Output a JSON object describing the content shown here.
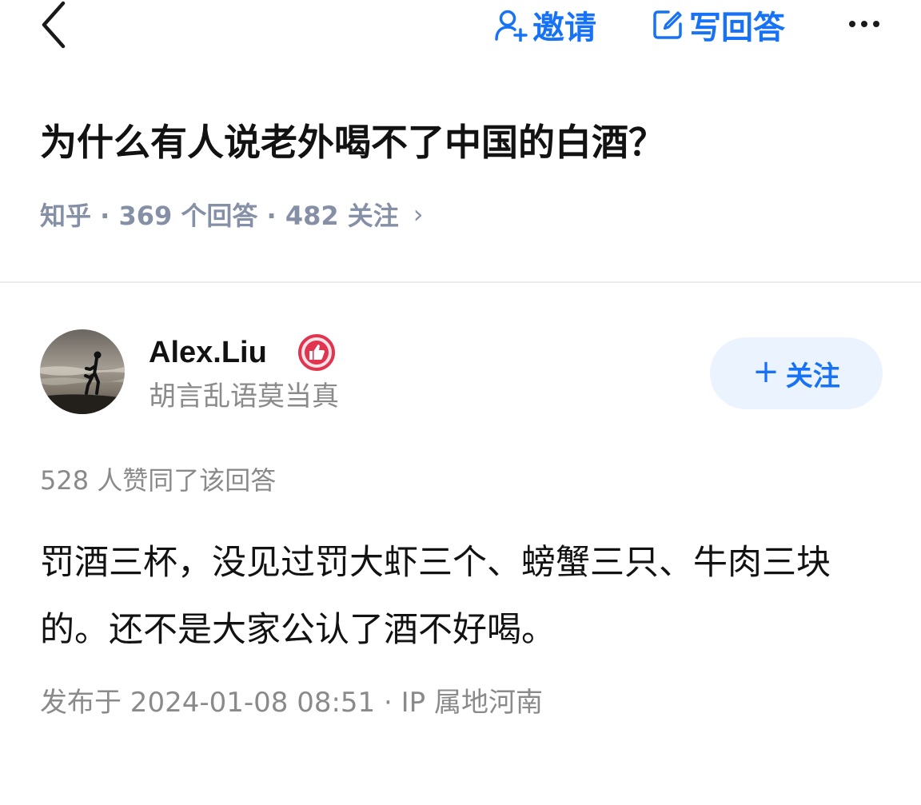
{
  "header": {
    "invite_label": "邀请",
    "write_answer_label": "写回答"
  },
  "question": {
    "title": "为什么有人说老外喝不了中国的白酒？",
    "meta": "知乎 · 369 个回答 · 482 关注",
    "meta_chevron": "›"
  },
  "answer": {
    "author_name": "Alex.Liu",
    "author_bio": "胡言乱语莫当真",
    "follow_plus": "+",
    "follow_label": "关注",
    "upvote_text": "528 人赞同了该回答",
    "content": "罚酒三杯，没见过罚大虾三个、螃蟹三只、牛肉三块的。还不是大家公认了酒不好喝。",
    "publish_info": "发布于 2024-01-08 08:51 · IP 属地河南"
  },
  "colors": {
    "accent": "#1772f6",
    "follow_bg": "#ebf3ff",
    "meta_gray": "#8590a6",
    "badge_red": "#e0344f"
  },
  "icons": {
    "back": "chevron-left-icon",
    "invite": "person-add-icon",
    "write": "edit-icon",
    "more": "more-horizontal-icon",
    "badge": "thumbs-up-badge-icon"
  }
}
